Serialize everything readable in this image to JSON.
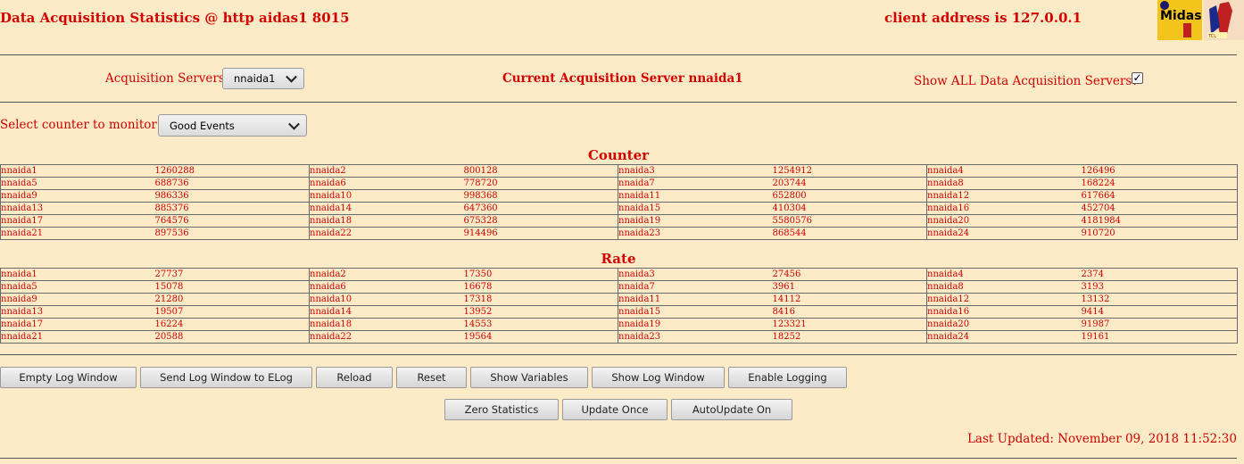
{
  "header": {
    "title": "Data Acquisition Statistics @ http aidas1 8015",
    "client": "client address is 127.0.0.1",
    "logo_text": "Midas",
    "logo_sub": "TCL"
  },
  "servers": {
    "label": "Acquisition Servers",
    "selected": "nnaida1",
    "current": "Current Acquisition Server nnaida1",
    "show_all_label": "Show ALL Data Acquisition Servers?",
    "show_all_checked": "✓"
  },
  "counter_select": {
    "label": "Select counter to monitor",
    "selected": "Good Events"
  },
  "counter": {
    "title": "Counter",
    "rows": [
      [
        [
          "nnaida1",
          "1260288"
        ],
        [
          "nnaida2",
          "800128"
        ],
        [
          "nnaida3",
          "1254912"
        ],
        [
          "nnaida4",
          "126496"
        ]
      ],
      [
        [
          "nnaida5",
          "688736"
        ],
        [
          "nnaida6",
          "778720"
        ],
        [
          "nnaida7",
          "203744"
        ],
        [
          "nnaida8",
          "168224"
        ]
      ],
      [
        [
          "nnaida9",
          "986336"
        ],
        [
          "nnaida10",
          "998368"
        ],
        [
          "nnaida11",
          "652800"
        ],
        [
          "nnaida12",
          "617664"
        ]
      ],
      [
        [
          "nnaida13",
          "885376"
        ],
        [
          "nnaida14",
          "647360"
        ],
        [
          "nnaida15",
          "410304"
        ],
        [
          "nnaida16",
          "452704"
        ]
      ],
      [
        [
          "nnaida17",
          "764576"
        ],
        [
          "nnaida18",
          "675328"
        ],
        [
          "nnaida19",
          "5580576"
        ],
        [
          "nnaida20",
          "4181984"
        ]
      ],
      [
        [
          "nnaida21",
          "897536"
        ],
        [
          "nnaida22",
          "914496"
        ],
        [
          "nnaida23",
          "868544"
        ],
        [
          "nnaida24",
          "910720"
        ]
      ]
    ]
  },
  "rate": {
    "title": "Rate",
    "rows": [
      [
        [
          "nnaida1",
          "27737"
        ],
        [
          "nnaida2",
          "17350"
        ],
        [
          "nnaida3",
          "27456"
        ],
        [
          "nnaida4",
          "2374"
        ]
      ],
      [
        [
          "nnaida5",
          "15078"
        ],
        [
          "nnaida6",
          "16678"
        ],
        [
          "nnaida7",
          "3961"
        ],
        [
          "nnaida8",
          "3193"
        ]
      ],
      [
        [
          "nnaida9",
          "21280"
        ],
        [
          "nnaida10",
          "17318"
        ],
        [
          "nnaida11",
          "14112"
        ],
        [
          "nnaida12",
          "13132"
        ]
      ],
      [
        [
          "nnaida13",
          "19507"
        ],
        [
          "nnaida14",
          "13952"
        ],
        [
          "nnaida15",
          "8416"
        ],
        [
          "nnaida16",
          "9414"
        ]
      ],
      [
        [
          "nnaida17",
          "16224"
        ],
        [
          "nnaida18",
          "14553"
        ],
        [
          "nnaida19",
          "123321"
        ],
        [
          "nnaida20",
          "91987"
        ]
      ],
      [
        [
          "nnaida21",
          "20588"
        ],
        [
          "nnaida22",
          "19564"
        ],
        [
          "nnaida23",
          "18252"
        ],
        [
          "nnaida24",
          "19161"
        ]
      ]
    ]
  },
  "buttons": {
    "empty_log": "Empty Log Window",
    "send_log": "Send Log Window to ELog",
    "reload": "Reload",
    "reset": "Reset",
    "show_vars": "Show Variables",
    "show_log": "Show Log Window",
    "enable_logging": "Enable Logging",
    "zero_stats": "Zero Statistics",
    "update_once": "Update Once",
    "autoupdate": "AutoUpdate On"
  },
  "last_updated": "Last Updated: November 09, 2018 11:52:30",
  "colors": {
    "background": "#fdebc8",
    "text": "#d40000"
  }
}
